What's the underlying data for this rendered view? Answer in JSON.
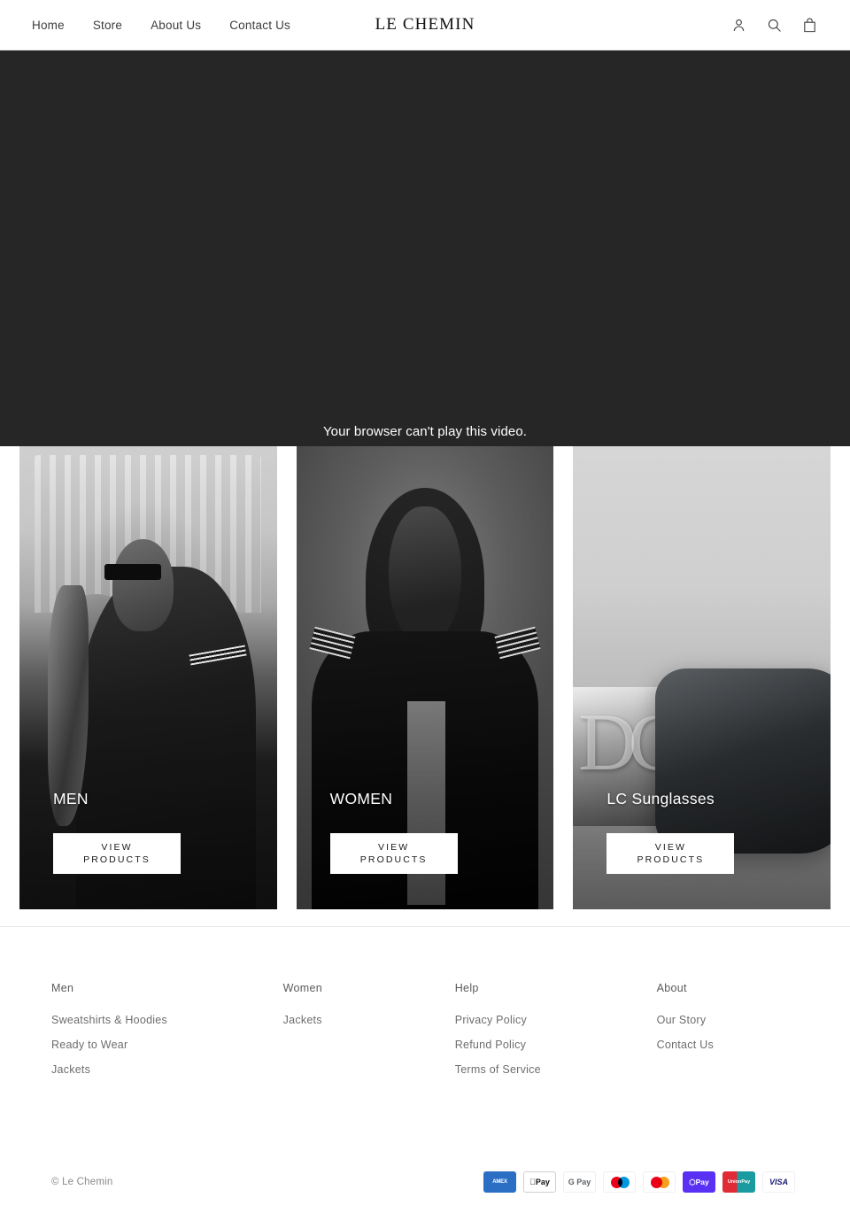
{
  "header": {
    "nav": [
      {
        "label": "Home"
      },
      {
        "label": "Store"
      },
      {
        "label": "About Us"
      },
      {
        "label": "Contact Us"
      }
    ],
    "logo": "LE CHEMIN",
    "icons": {
      "account": "account-icon",
      "search": "search-icon",
      "cart": "shopping-bag-icon"
    }
  },
  "hero": {
    "video_fallback_message": "Your browser can't play this video."
  },
  "collections": [
    {
      "title": "MEN",
      "button_line1": "VIEW",
      "button_line2": "PRODUCTS",
      "image_alt": "saxophonist-in-varsity-jacket"
    },
    {
      "title": "WOMEN",
      "button_line1": "VIEW",
      "button_line2": "PRODUCTS",
      "image_alt": "woman-portrait-in-varsity-jacket"
    },
    {
      "title": "LC Sunglasses",
      "button_line1": "VIEW",
      "button_line2": "PRODUCTS",
      "image_alt": "lc-monogram-sunglasses-closeup"
    }
  ],
  "footer": {
    "columns": [
      {
        "heading": "Men",
        "links": [
          {
            "label": "Sweatshirts & Hoodies"
          },
          {
            "label": "Ready to Wear"
          },
          {
            "label": "Jackets"
          }
        ]
      },
      {
        "heading": "Women",
        "links": [
          {
            "label": "Jackets"
          }
        ]
      },
      {
        "heading": "Help",
        "links": [
          {
            "label": "Privacy Policy"
          },
          {
            "label": "Refund Policy"
          },
          {
            "label": "Terms of Service"
          }
        ]
      },
      {
        "heading": "About",
        "links": [
          {
            "label": "Our Story"
          },
          {
            "label": "Contact Us"
          }
        ]
      }
    ],
    "copyright": "© Le Chemin",
    "payments": [
      {
        "name": "american-express",
        "label": "AMEX"
      },
      {
        "name": "apple-pay",
        "label": "Pay"
      },
      {
        "name": "google-pay",
        "label": "G Pay"
      },
      {
        "name": "maestro",
        "label": ""
      },
      {
        "name": "mastercard",
        "label": ""
      },
      {
        "name": "shop-pay",
        "label": "Pay"
      },
      {
        "name": "union-pay",
        "label": "UnionPay"
      },
      {
        "name": "visa",
        "label": "VISA"
      }
    ]
  },
  "colors": {
    "page_background": "#ffffff",
    "hero_background": "#262626",
    "text_primary": "#1a1a1a",
    "text_muted": "#6d6d6d",
    "divider": "#e8e8e8"
  }
}
